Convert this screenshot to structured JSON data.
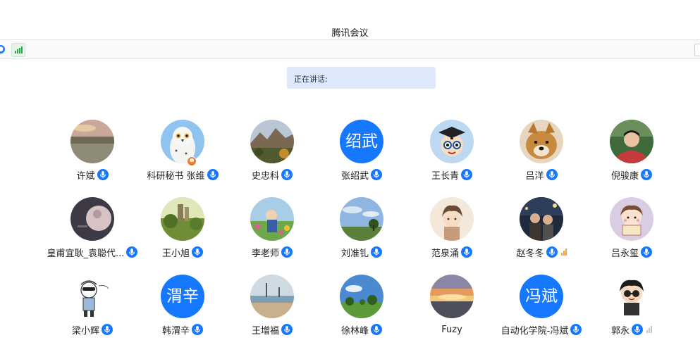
{
  "window": {
    "title": "腾讯会议"
  },
  "toolbar": {
    "left_icon": "status-icon",
    "network_icon": "network-signal-icon"
  },
  "speaking_bar": {
    "label": "正在讲话:"
  },
  "participants": [
    {
      "name": "许斌",
      "avatar": "photo-lake",
      "mic": "on"
    },
    {
      "name": "科研秘书 张维",
      "avatar": "photo-owl",
      "mic": "on",
      "badge": "host-icon"
    },
    {
      "name": "史忠科",
      "avatar": "photo-mountain",
      "mic": "on"
    },
    {
      "name": "张绍武",
      "avatar_text": "绍武",
      "mic": "on"
    },
    {
      "name": "王长青",
      "avatar": "photo-cartoon-graduate",
      "mic": "on"
    },
    {
      "name": "吕洋",
      "avatar": "photo-dog",
      "mic": "on"
    },
    {
      "name": "倪骏康",
      "avatar": "photo-person",
      "mic": "on"
    },
    {
      "name": "皇甫宜耿_袁聪代...",
      "avatar": "photo-dark",
      "mic": "on"
    },
    {
      "name": "王小旭",
      "avatar": "photo-castle",
      "mic": "on"
    },
    {
      "name": "李老师",
      "avatar": "photo-garden",
      "mic": "on"
    },
    {
      "name": "刘准钆",
      "avatar": "photo-sky-tree",
      "mic": "on"
    },
    {
      "name": "范泉涌",
      "avatar": "photo-anime",
      "mic": "on"
    },
    {
      "name": "赵冬冬",
      "avatar": "photo-night-couple",
      "mic": "on",
      "signal": "weak"
    },
    {
      "name": "吕永玺",
      "avatar": "photo-cartoon-girl",
      "mic": "on"
    },
    {
      "name": "梁小辉",
      "avatar": "photo-sketch",
      "mic": "on"
    },
    {
      "name": "韩渭辛",
      "avatar_text": "渭辛",
      "mic": "on"
    },
    {
      "name": "王增福",
      "avatar": "photo-beach",
      "mic": "on"
    },
    {
      "name": "徐林峰",
      "avatar": "photo-field",
      "mic": "on"
    },
    {
      "name": "Fuzy",
      "avatar": "photo-sunset",
      "mic": "none"
    },
    {
      "name": "自动化学院-冯斌",
      "avatar_text": "冯斌",
      "mic": "on"
    },
    {
      "name": "郭永",
      "avatar": "photo-cartoon-boy",
      "mic": "on",
      "signal": "grey"
    }
  ],
  "colors": {
    "accent": "#1677ff",
    "speaking_bg": "#dde9fb",
    "signal_weak": "#f1a53a"
  }
}
